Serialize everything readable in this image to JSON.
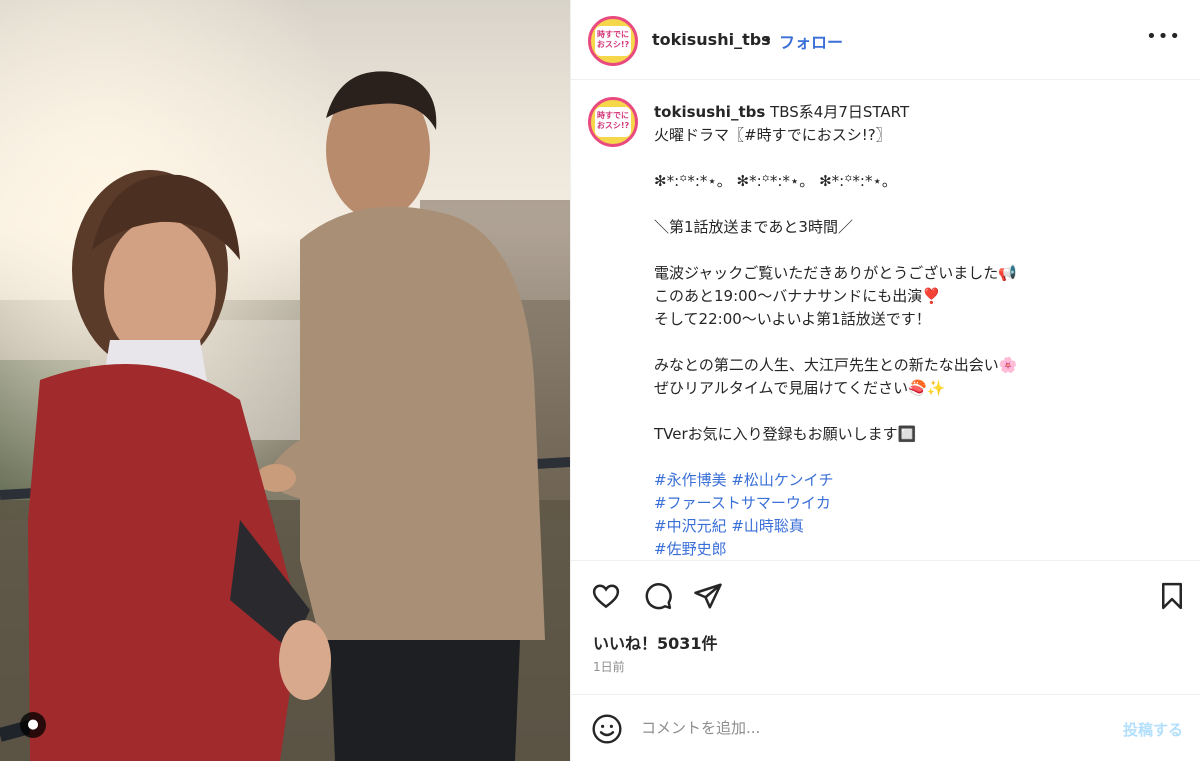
{
  "photo": {
    "alt": "Two people standing by a blue and yellow railing at sunset",
    "user_tag_icon": "person-icon"
  },
  "header": {
    "username": "tokisushi_tbs",
    "separator": "•",
    "follow_label": "フォロー",
    "more_icon": "more-horizontal-icon",
    "avatar_text": "時すでにおスシ!?"
  },
  "caption": {
    "username": "tokisushi_tbs",
    "lines": [
      "TBS系4月7日START",
      "火曜ドラマ〖#時すでにおスシ!?〗",
      "",
      "✻*:꙳*:*⋆。 ✻*:꙳*:*⋆。 ✻*:꙳*:*⋆。",
      "",
      "＼第1話放送まであと3時間／",
      "",
      "電波ジャックご覧いただきありがとうございました📢",
      "このあと19:00〜バナナサンドにも出演❣️",
      "そして22:00〜いよいよ第1話放送です！",
      "",
      "みなとの第二の人生、大江戸先生との新たな出会い🌸",
      "ぜひリアルタイムで見届けてください🍣✨",
      "",
      "TVerお気に入り登録もお願いします🔲"
    ],
    "hashtag_rows": [
      [
        "#永作博美",
        "#松山ケンイチ"
      ],
      [
        "#ファーストサマーウイカ"
      ],
      [
        "#中沢元紀",
        "#山時聡真"
      ],
      [
        "#佐野史郎"
      ]
    ]
  },
  "actions": {
    "like_icon": "heart-icon",
    "comment_icon": "comment-icon",
    "share_icon": "send-icon",
    "save_icon": "bookmark-icon"
  },
  "likes_text": "いいね！5031件",
  "time_ago": "1日前",
  "comment": {
    "emoji_icon": "smiley-icon",
    "placeholder": "コメントを追加...",
    "post_label": "投稿する"
  },
  "colors": {
    "link_blue": "#3a6fd8",
    "post_disabled": "#b2dffc",
    "avatar_ring": "#e94a7f",
    "avatar_fill": "#f6d64a"
  }
}
